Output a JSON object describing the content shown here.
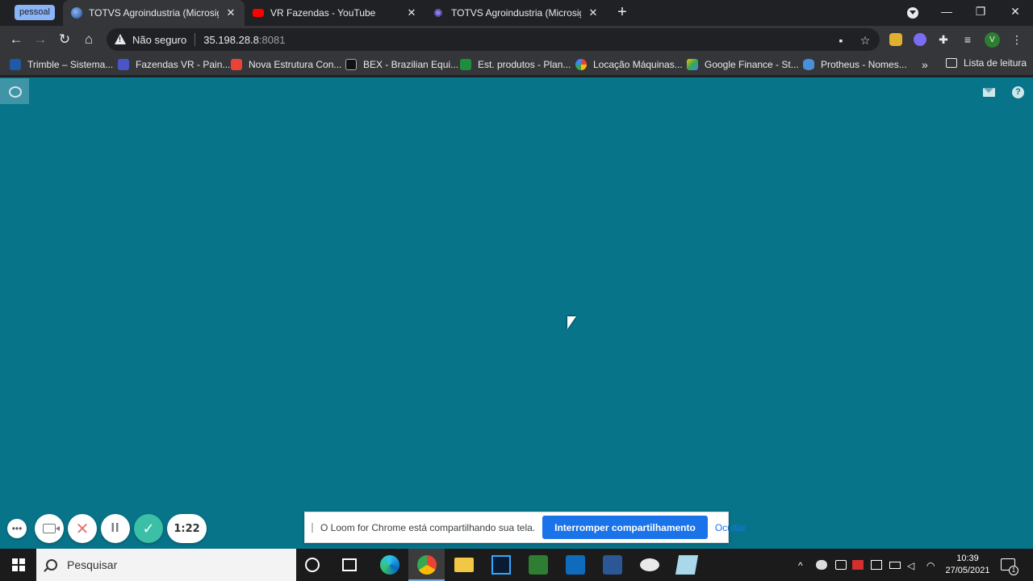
{
  "browser": {
    "profile_chip": "pessoal",
    "tabs": [
      {
        "title": "TOTVS Agroindustria (Microsiga)",
        "active": true
      },
      {
        "title": "VR Fazendas - YouTube",
        "active": false
      },
      {
        "title": "TOTVS Agroindustria (Microsiga)",
        "active": false
      }
    ],
    "security_label": "Não seguro",
    "url_host": "35.198.28.8",
    "url_port": ":8081",
    "avatar_letter": "V"
  },
  "bookmarks": {
    "items": [
      "Trimble – Sistema...",
      "Fazendas VR - Pain...",
      "Nova Estrutura Con...",
      "BEX - Brazilian Equi...",
      "Est. produtos - Plan...",
      "Locação Máquinas...",
      "Google Finance - St...",
      "Protheus - Nomes..."
    ],
    "more": "»",
    "reading_list": "Lista de leitura"
  },
  "page": {
    "help_glyph": "?"
  },
  "loom": {
    "more_glyph": "•••",
    "cancel_glyph": "✕",
    "pause_glyph": "II",
    "done_glyph": "✓",
    "timer": "1:22",
    "share_text": "O Loom for Chrome está compartilhando sua tela.",
    "stop_button": "Interromper compartilhamento",
    "hide_button": "Ocultar"
  },
  "taskbar": {
    "search_placeholder": "Pesquisar",
    "time": "10:39",
    "date": "27/05/2021",
    "notification_count": "1"
  },
  "colors": {
    "page_background": "#08748a",
    "primary_button": "#1a73e8",
    "loom_done": "#3bbfa7"
  }
}
